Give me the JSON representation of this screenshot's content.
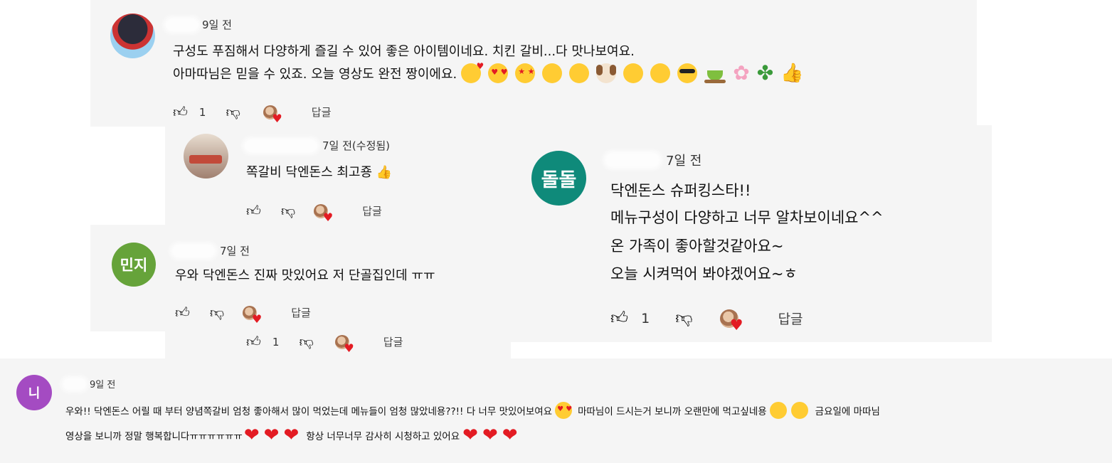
{
  "comments": [
    {
      "time": "9일 전",
      "lines": [
        "구성도 푸짐해서 다양하게 즐길 수 있어 좋은 아이템이네요. 치킨 갈비...다 맛나보여요.",
        "아마따님은 믿을 수 있죠. 오늘 영상도 완전 짱이에요."
      ],
      "emoji_names": [
        "smiling-face-with-hearts",
        "heart-eyes",
        "star-struck",
        "drooling-face",
        "grinning-face",
        "dog-face",
        "squinting-face",
        "smiling-face",
        "sunglasses-face",
        "tea",
        "cherry-blossom",
        "four-leaf-clover",
        "thumbs-up"
      ],
      "likes": "1",
      "reply": "답글"
    },
    {
      "time": "7일 전(수정됨)",
      "name_partial": "ㅅㅓ ㅐ 므ㅎ",
      "text": "쪽갈비 닥엔돈스 최고죵 👍",
      "reply": "답글"
    },
    {
      "avatar_text": "돌돌",
      "time": "7일 전",
      "lines": [
        "닥엔돈스 슈퍼킹스타!!",
        "메뉴구성이 다양하고 너무 알차보이네요^^",
        "온 가족이 좋아할것같아요~",
        "오늘 시켜먹어 봐야겠어요~ㅎ"
      ],
      "likes": "1",
      "reply": "답글"
    },
    {
      "avatar_text": "민지",
      "time": "7일 전",
      "text": "우와 닥엔돈스 진짜 맛있어요 저 단골집인데 ㅠㅠ",
      "reply": "답글"
    },
    {
      "likes": "1",
      "reply": "답글"
    },
    {
      "avatar_text": "니",
      "time": "9일 전",
      "line1": "우와!! 닥엔돈스 어릴 때 부터 양념쪽갈비 엄청 좋아해서 많이 먹었는데 메뉴들이 엄청 많았네용??!! 다 너무 맛있어보여요",
      "line1b": "마따님이 드시는거 보니까 오랜만에 먹고싶네용",
      "line1c": "금요일에 마따님",
      "line2": "영상을 보니까 정말 행복합니다ㅠㅠㅠㅠㅠㅠ",
      "line2b": "항상 너무너무 감사히 시청하고 있어요"
    }
  ],
  "colors": {
    "panel": "#f5f5f5",
    "avatar_dol": "#0f8a7a",
    "avatar_minji": "#66a33a",
    "avatar_ni": "#a44bc2",
    "heart": "#e31b23"
  }
}
